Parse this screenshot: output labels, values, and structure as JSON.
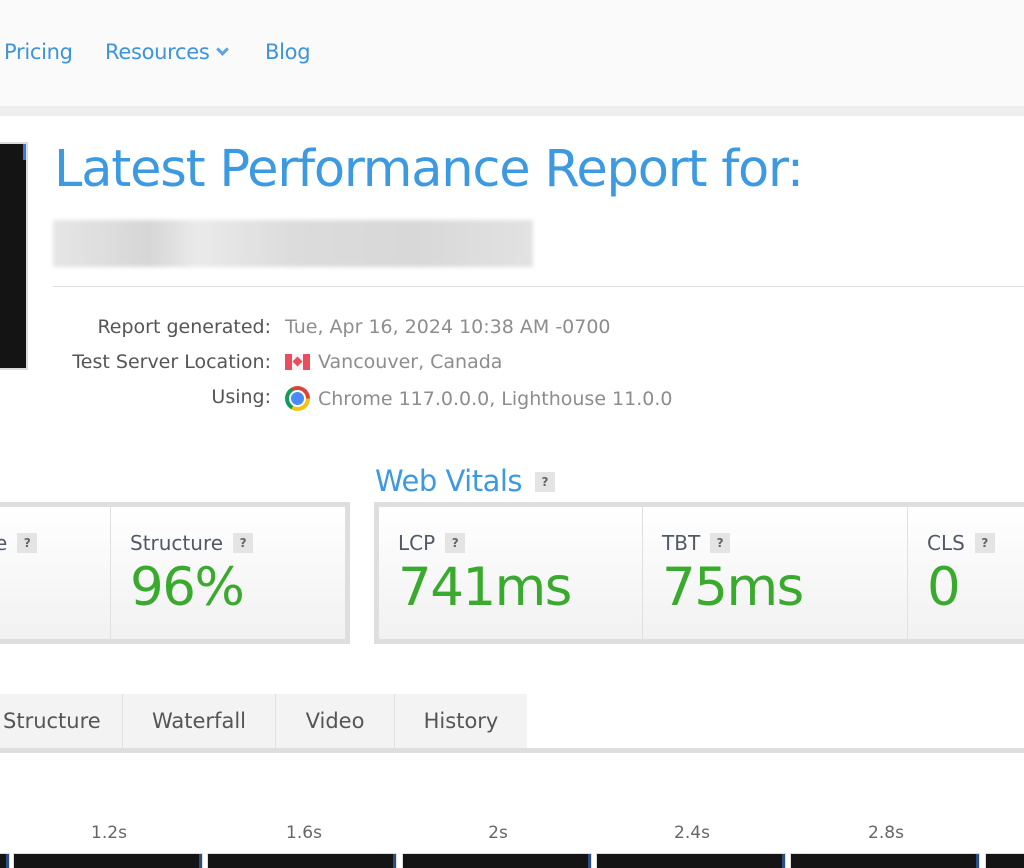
{
  "nav": {
    "items": [
      {
        "label": "Pricing"
      },
      {
        "label": "Resources",
        "has_dropdown": true,
        "icon": "chevron-down-icon"
      },
      {
        "label": "Blog"
      }
    ]
  },
  "report": {
    "title": "Latest Performance Report for:",
    "url": "(blurred)",
    "info": [
      {
        "label": "Report generated:",
        "value": "Tue, Apr 16, 2024 10:38 AM -0700"
      },
      {
        "label": "Test Server Location:",
        "value": "Vancouver, Canada",
        "icon": "canada-flag-icon"
      },
      {
        "label": "Using:",
        "value": "Chrome 117.0.0.0, Lighthouse 11.0.0",
        "icon": "chrome-icon"
      }
    ]
  },
  "grades": {
    "metrics": [
      {
        "label": "e",
        "value": ""
      },
      {
        "label": "Structure",
        "value": "96%"
      }
    ]
  },
  "web_vitals": {
    "heading": "Web Vitals",
    "help": "?",
    "metrics": [
      {
        "label": "LCP",
        "value": "741ms"
      },
      {
        "label": "TBT",
        "value": "75ms"
      },
      {
        "label": "CLS",
        "value": "0"
      }
    ]
  },
  "help_glyph": "?",
  "tabs": [
    {
      "label": "Structure"
    },
    {
      "label": "Waterfall"
    },
    {
      "label": "Video"
    },
    {
      "label": "History"
    }
  ],
  "filmstrip": {
    "times": [
      "1.2s",
      "1.6s",
      "2s",
      "2.4s",
      "2.8s"
    ]
  },
  "colors": {
    "accent": "#3d9ae0",
    "good": "#3aaa2e"
  }
}
